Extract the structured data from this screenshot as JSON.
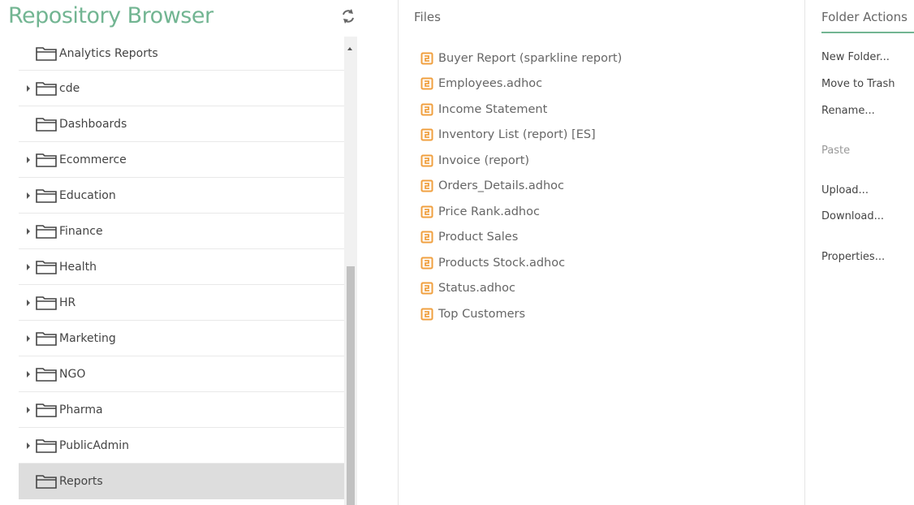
{
  "header": {
    "title": "Repository Browser",
    "refresh_icon": "refresh-icon"
  },
  "tree": {
    "items": [
      {
        "label": "Analytics Reports",
        "expandable": false,
        "selected": false
      },
      {
        "label": "cde",
        "expandable": true,
        "selected": false
      },
      {
        "label": "Dashboards",
        "expandable": false,
        "selected": false
      },
      {
        "label": "Ecommerce",
        "expandable": true,
        "selected": false
      },
      {
        "label": "Education",
        "expandable": true,
        "selected": false
      },
      {
        "label": "Finance",
        "expandable": true,
        "selected": false
      },
      {
        "label": "Health",
        "expandable": true,
        "selected": false
      },
      {
        "label": "HR",
        "expandable": true,
        "selected": false
      },
      {
        "label": "Marketing",
        "expandable": true,
        "selected": false
      },
      {
        "label": "NGO",
        "expandable": true,
        "selected": false
      },
      {
        "label": "Pharma",
        "expandable": true,
        "selected": false
      },
      {
        "label": "PublicAdmin",
        "expandable": true,
        "selected": false
      },
      {
        "label": "Reports",
        "expandable": false,
        "selected": true
      }
    ]
  },
  "files": {
    "title": "Files",
    "items": [
      "Buyer Report (sparkline report)",
      "Employees.adhoc",
      "Income Statement",
      "Inventory List (report) [ES]",
      "Invoice (report)",
      "Orders_Details.adhoc",
      "Price Rank.adhoc",
      "Product Sales",
      "Products Stock.adhoc",
      "Status.adhoc",
      "Top Customers"
    ]
  },
  "actions": {
    "title": "Folder Actions",
    "new_folder": "New Folder...",
    "move_to_trash": "Move to Trash",
    "rename": "Rename...",
    "paste": "Paste",
    "upload": "Upload...",
    "download": "Download...",
    "properties": "Properties..."
  },
  "colors": {
    "accent": "#72b592",
    "file_icon": "#f0a040",
    "selected_bg": "#dddddd"
  }
}
